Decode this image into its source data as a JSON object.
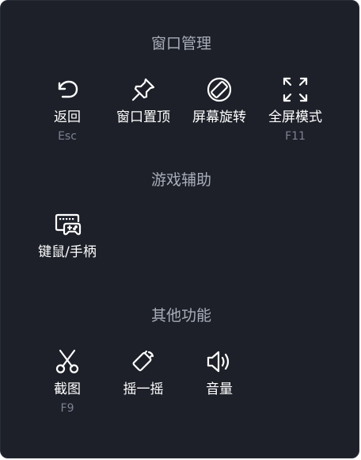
{
  "sections": [
    {
      "title": "窗口管理",
      "items": [
        {
          "label": "返回",
          "shortcut": "Esc",
          "icon": "back-icon"
        },
        {
          "label": "窗口置顶",
          "shortcut": "",
          "icon": "pin-icon"
        },
        {
          "label": "屏幕旋转",
          "shortcut": "",
          "icon": "rotate-icon"
        },
        {
          "label": "全屏模式",
          "shortcut": "F11",
          "icon": "fullscreen-icon"
        }
      ]
    },
    {
      "title": "游戏辅助",
      "items": [
        {
          "label": "键鼠/手柄",
          "shortcut": "",
          "icon": "keyboard-gamepad-icon"
        }
      ]
    },
    {
      "title": "其他功能",
      "items": [
        {
          "label": "截图",
          "shortcut": "F9",
          "icon": "scissors-icon"
        },
        {
          "label": "摇一摇",
          "shortcut": "",
          "icon": "shake-icon"
        },
        {
          "label": "音量",
          "shortcut": "",
          "icon": "volume-icon"
        }
      ]
    }
  ],
  "colors": {
    "panel_bg": "#1d2029",
    "title_text": "#a8adb8",
    "label_text": "#ffffff",
    "shortcut_text": "#7c8290"
  }
}
